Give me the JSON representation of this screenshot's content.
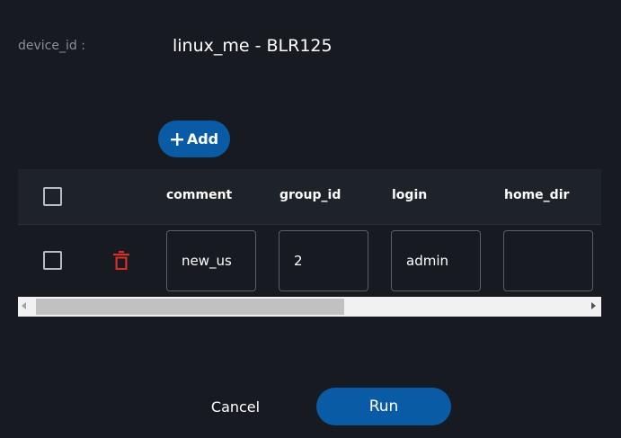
{
  "form": {
    "device_label": "device_id :",
    "device_value": "linux_me - BLR125"
  },
  "toolbar": {
    "add_label": "Add"
  },
  "table": {
    "columns": [
      "comment",
      "group_id",
      "login",
      "home_dir"
    ],
    "rows": [
      {
        "comment": "new_us",
        "group_id": "2",
        "login": "admin",
        "home_dir": ""
      }
    ],
    "scroll_position": 0.0
  },
  "footer": {
    "cancel_label": "Cancel",
    "run_label": "Run"
  },
  "colors": {
    "background": "#171a20",
    "primary": "#0a5ba6",
    "delete": "#d93025"
  }
}
